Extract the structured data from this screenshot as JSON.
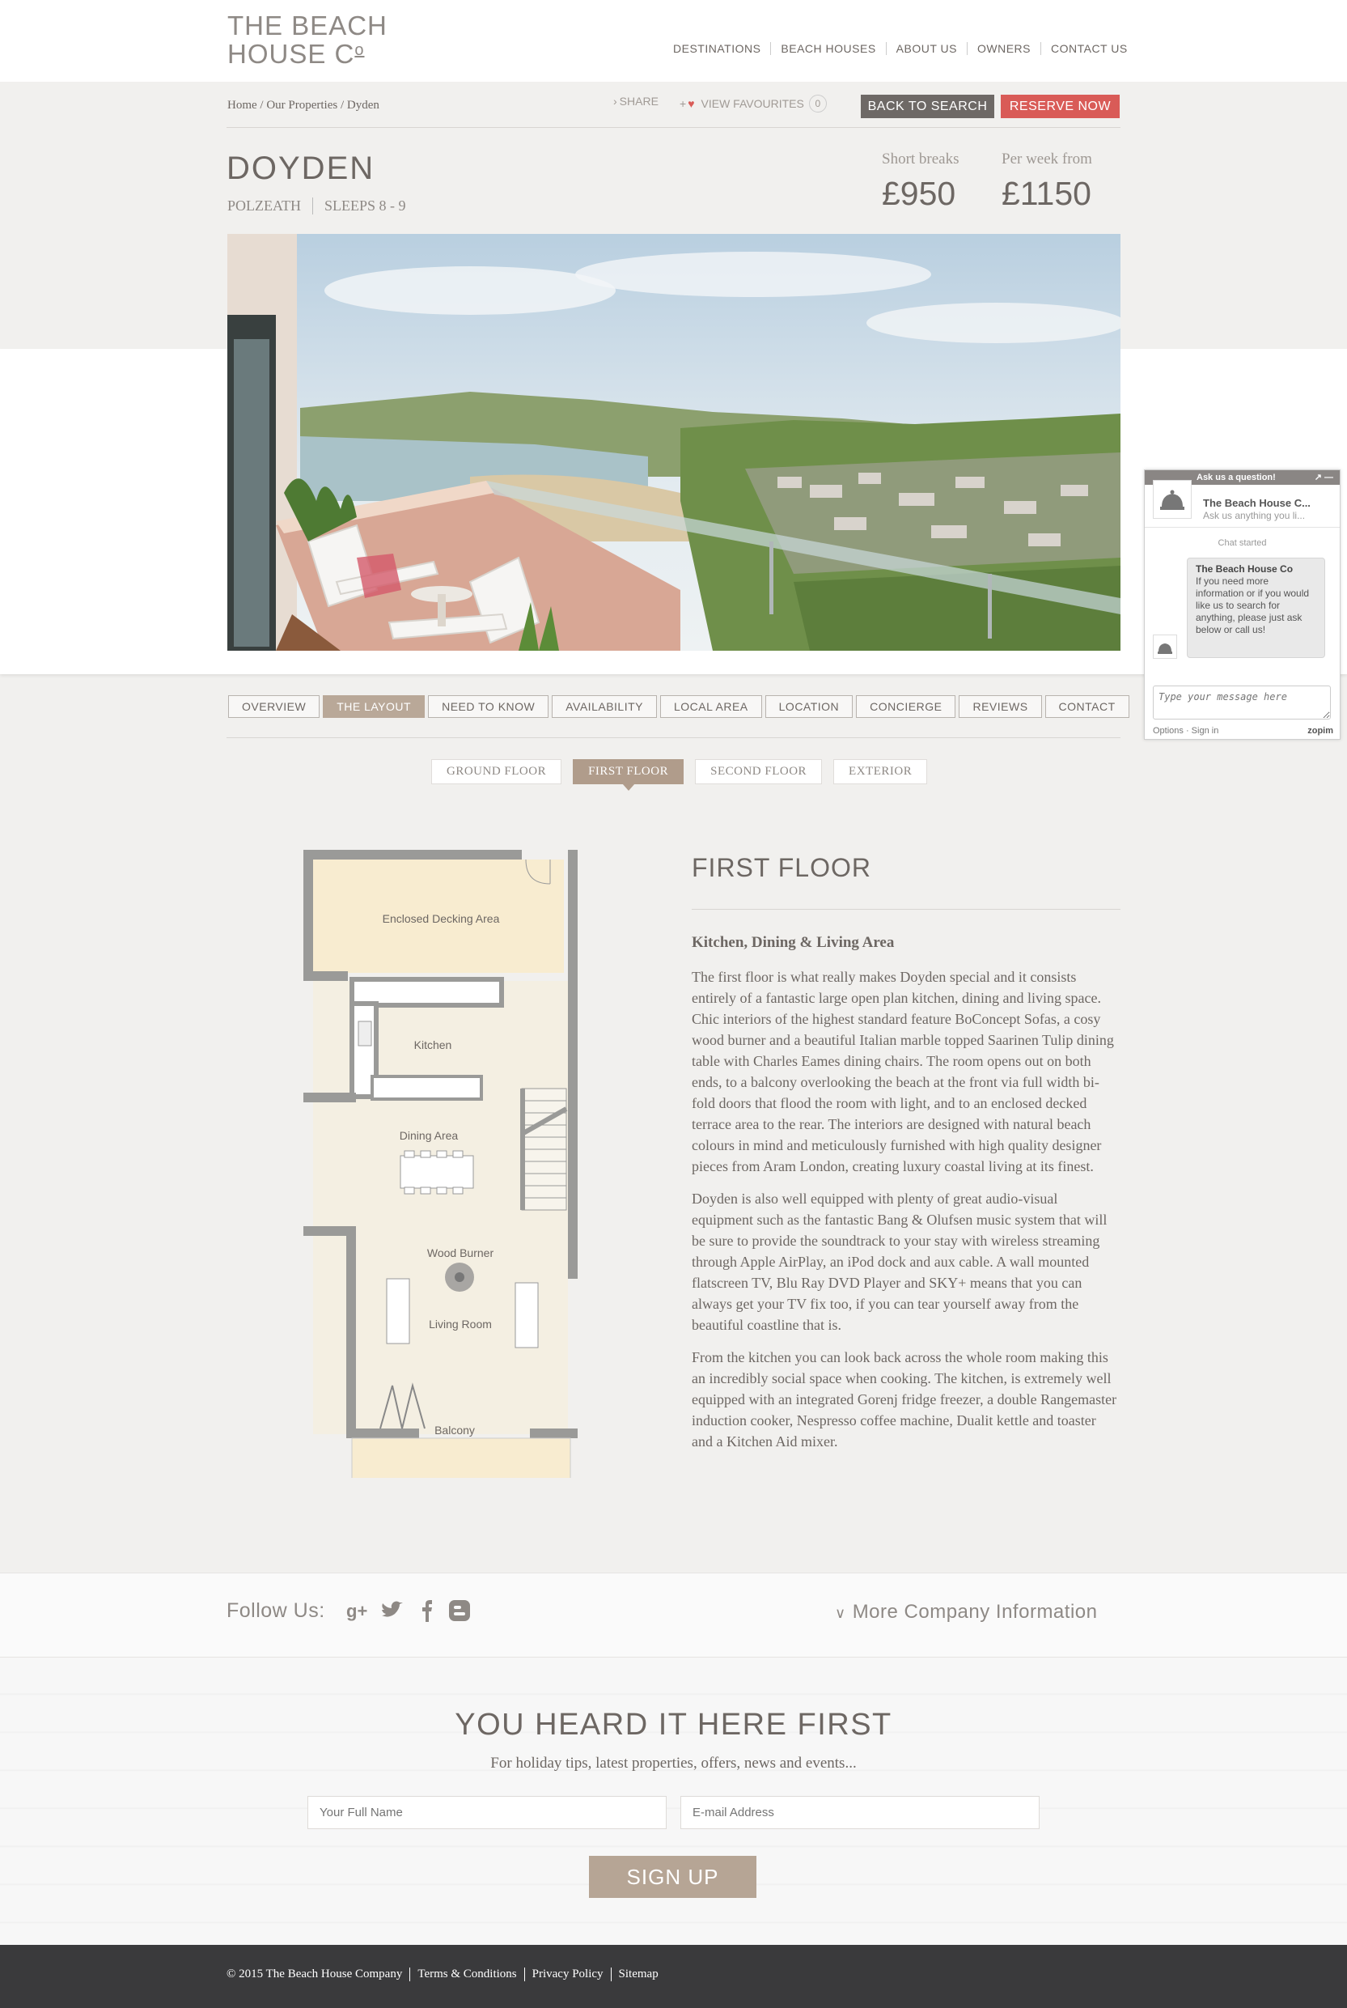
{
  "header": {
    "logo_line1": "THE BEACH",
    "logo_line2": "HOUSE C",
    "logo_sup": "o",
    "nav": [
      "DESTINATIONS",
      "BEACH HOUSES",
      "ABOUT US",
      "OWNERS",
      "CONTACT US"
    ]
  },
  "toolbar": {
    "breadcrumb": "Home / Our Properties / Dyden",
    "share": "SHARE",
    "favourites": "VIEW FAVOURITES",
    "fav_count": "0",
    "back": "BACK TO SEARCH",
    "reserve": "RESERVE NOW"
  },
  "property": {
    "name": "DOYDEN",
    "location": "POLZEATH",
    "sleeps": "SLEEPS 8 - 9",
    "short_breaks_label": "Short breaks",
    "short_breaks_price": "£950",
    "per_week_label": "Per week from",
    "per_week_price": "£1150"
  },
  "tabs": [
    "OVERVIEW",
    "THE LAYOUT",
    "NEED TO KNOW",
    "AVAILABILITY",
    "LOCAL AREA",
    "LOCATION",
    "CONCIERGE",
    "REVIEWS",
    "CONTACT"
  ],
  "floors": [
    "GROUND FLOOR",
    "FIRST FLOOR",
    "SECOND FLOOR",
    "EXTERIOR"
  ],
  "plan": {
    "rooms": [
      "Enclosed Decking Area",
      "Kitchen",
      "Dining Area",
      "Wood Burner",
      "Living Room",
      "Balcony"
    ]
  },
  "content": {
    "heading": "FIRST FLOOR",
    "subheading": "Kitchen, Dining & Living Area",
    "p1": "The first floor is what really makes Doyden special and it consists entirely of a fantastic large open plan kitchen, dining and living space. Chic interiors of the highest standard feature BoConcept Sofas, a cosy wood burner and a beautiful Italian marble topped Saarinen Tulip dining table with Charles Eames dining chairs. The room opens out on both ends, to a balcony overlooking the beach at the front via full width bi-fold doors that flood the room with light, and to an enclosed decked terrace area to the rear. The interiors are designed with natural beach colours in mind and meticulously furnished with high quality designer pieces from Aram London, creating luxury coastal living at its finest.",
    "p2": "Doyden is also well equipped with plenty of great audio-visual equipment such as the fantastic Bang & Olufsen music system that will be sure to provide the soundtrack to your stay with wireless streaming through Apple AirPlay, an iPod dock and aux cable. A wall mounted flatscreen TV, Blu Ray DVD Player and SKY+ means that you can always get your TV fix too, if you can tear yourself away from the beautiful coastline that is.",
    "p3": "From the kitchen you can look back across the whole room making this an incredibly social space when cooking. The kitchen, is extremely well equipped with an integrated Gorenj fridge freezer, a double Rangemaster induction cooker, Nespresso coffee machine, Dualit kettle and toaster and a Kitchen Aid mixer."
  },
  "follow": {
    "label": "Follow Us:",
    "more": "More Company Information"
  },
  "newsletter": {
    "title": "YOU HEARD IT HERE FIRST",
    "subtitle": "For holiday tips, latest properties, offers, news and events...",
    "name_placeholder": "Your Full Name",
    "email_placeholder": "E-mail Address",
    "button": "SIGN UP"
  },
  "footer": {
    "copyright": "© 2015 The Beach House Company",
    "links": [
      "Terms & Conditions",
      "Privacy Policy",
      "Sitemap"
    ]
  },
  "chat": {
    "header": "Ask us a question!",
    "controls": "↗ —",
    "name": "The Beach House C...",
    "tagline": "Ask us anything you li...",
    "started": "Chat started",
    "sender": "The Beach House Co",
    "message": "If you need more information or if you would like us to search for anything, please just ask below or call us!",
    "input_placeholder": "Type your message here",
    "options": "Options · Sign in",
    "brand": "zopim"
  },
  "colors": {
    "accent": "#b9a898",
    "reserve": "#d95b57",
    "back": "#6e6966",
    "text": "#6d6763",
    "footer_bg": "#3a3a3c"
  }
}
